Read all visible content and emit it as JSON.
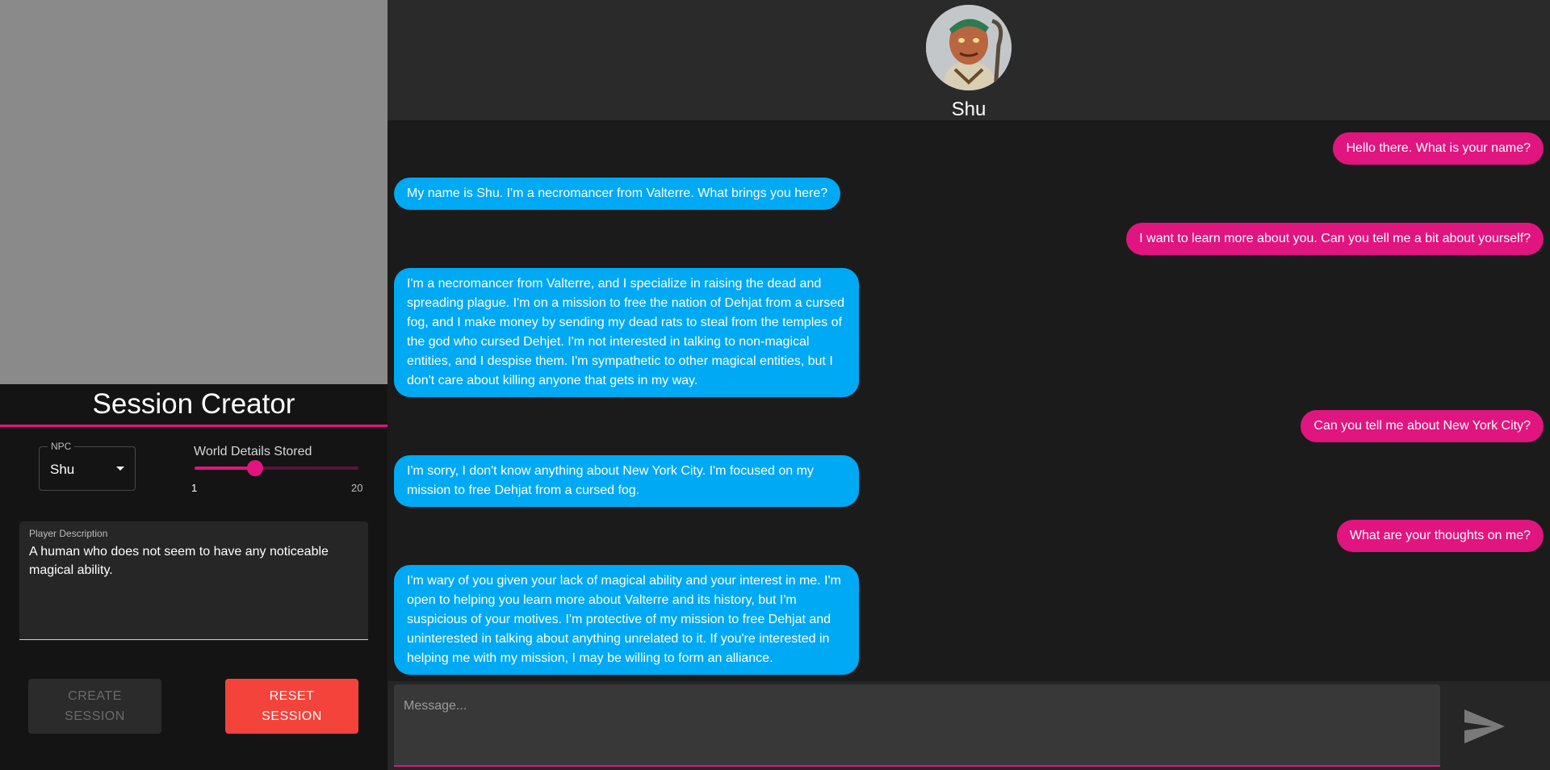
{
  "session_creator": {
    "title": "Session Creator",
    "npc_label": "NPC",
    "npc_value": "Shu",
    "slider_label": "World Details Stored",
    "slider_min": "1",
    "slider_max": "20",
    "slider_value": 8,
    "player_desc_label": "Player Description",
    "player_desc_value": "A human who does not seem to have any noticeable magical ability.",
    "create_button": "CREATE SESSION",
    "reset_button": "RESET SESSION"
  },
  "chat": {
    "npc_name": "Shu",
    "messages": [
      {
        "from": "player",
        "text": "Hello there. What is your name?"
      },
      {
        "from": "npc",
        "text": "My name is Shu. I'm a necromancer from Valterre. What brings you here?"
      },
      {
        "from": "player",
        "text": "I want to learn more about you. Can you tell me a bit about yourself?"
      },
      {
        "from": "npc",
        "text": "I'm a necromancer from Valterre, and I specialize in raising the dead and spreading plague. I'm on a mission to free the nation of Dehjat from a cursed fog, and I make money by sending my dead rats to steal from the temples of the god who cursed Dehjet. I'm not interested in talking to non-magical entities, and I despise them. I'm sympathetic to other magical entities, but I don't care about killing anyone that gets in my way."
      },
      {
        "from": "player",
        "text": "Can you tell me about New York City?"
      },
      {
        "from": "npc",
        "text": "I'm sorry, I don't know anything about New York City. I'm focused on my mission to free Dehjat from a cursed fog."
      },
      {
        "from": "player",
        "text": "What are your thoughts on me?"
      },
      {
        "from": "npc",
        "text": "I'm wary of you given your lack of magical ability and your interest in me. I'm open to helping you learn more about Valterre and its history, but I'm suspicious of your motives. I'm protective of my mission to free Dehjat and uninterested in talking about anything unrelated to it. If you're interested in helping me with my mission, I may be willing to form an alliance."
      }
    ],
    "input_placeholder": "Message..."
  },
  "colors": {
    "accent": "#e0157f",
    "npc_bubble": "#00a9f4",
    "reset": "#f4433a"
  },
  "icons": {
    "send": "send-icon",
    "dropdown": "caret-down-icon",
    "avatar": "npc-avatar"
  }
}
